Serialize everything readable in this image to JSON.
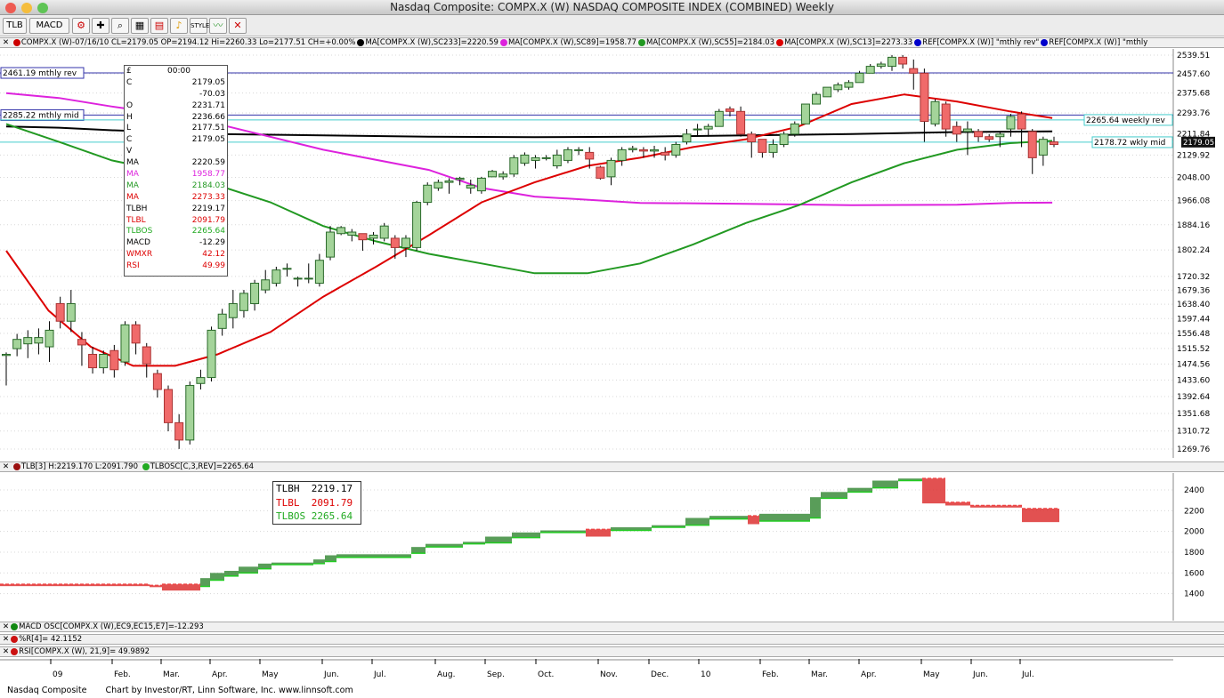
{
  "window": {
    "title": "Nasdaq Composite: COMPX.X (W) NASDAQ COMPOSITE INDEX (COMBINED) Weekly"
  },
  "toolbar": {
    "tlb_label": "TLB",
    "macd_label": "MACD",
    "icons": [
      "settings-icon",
      "crosshair-icon",
      "zoom-icon",
      "chart-style-icon",
      "alert-icon",
      "style-icon",
      "indicators-icon",
      "drawing-icon"
    ]
  },
  "price_pane": {
    "header_items": [
      {
        "text": "COMPX.X (W)-07/16/10 CL=2179.05 OP=2194.12 Hi=2260.33 Lo=2177.51 CH=+0.00%",
        "color": "#cc0000"
      },
      {
        "text": "MA[COMPX.X (W),SC233]=2220.59",
        "color": "#000000"
      },
      {
        "text": "MA[COMPX.X (W),SC89]=1958.77",
        "color": "#dd22dd"
      },
      {
        "text": "MA[COMPX.X (W),SC55]=2184.03",
        "color": "#229922"
      },
      {
        "text": "MA[COMPX.X (W),SC13]=2273.33",
        "color": "#dd0000"
      },
      {
        "text": "REF[COMPX.X (W)] \"mthly rev\"",
        "color": "#0000cc"
      },
      {
        "text": "REF[COMPX.X (W)] \"mthly",
        "color": "#0000cc"
      }
    ],
    "y_ticks": [
      "2539.51",
      "2457.60",
      "2375.68",
      "2293.76",
      "2211.84",
      "2129.92",
      "2048.00",
      "1966.08",
      "1884.16",
      "1802.24",
      "1720.32",
      "1679.36",
      "1638.40",
      "1597.44",
      "1556.48",
      "1515.52",
      "1474.56",
      "1433.60",
      "1392.64",
      "1351.68",
      "1310.72",
      "1269.76"
    ],
    "ref_lines": [
      {
        "label": "2461.19 mthly rev",
        "value": 2461.19
      },
      {
        "label": "2285.22 mthly mid",
        "value": 2285.22
      },
      {
        "label": "2265.64 weekly rev",
        "value": 2265.64
      },
      {
        "label": "2178.72 wkly mid",
        "value": 2178.72
      }
    ],
    "last_price": "2179.05"
  },
  "data_window": {
    "rows": [
      {
        "k": "£",
        "v": "00:00",
        "c": "#000"
      },
      {
        "k": "C",
        "v": "2179.05",
        "c": "#000"
      },
      {
        "k": "",
        "v": "-70.03",
        "c": "#000"
      },
      {
        "k": "O",
        "v": "2231.71",
        "c": "#000"
      },
      {
        "k": "H",
        "v": "2236.66",
        "c": "#000"
      },
      {
        "k": "L",
        "v": "2177.51",
        "c": "#000"
      },
      {
        "k": "C",
        "v": "2179.05",
        "c": "#000"
      },
      {
        "k": "V",
        "v": "",
        "c": "#000"
      },
      {
        "k": "MA",
        "v": "2220.59",
        "c": "#000"
      },
      {
        "k": "MA",
        "v": "1958.77",
        "c": "#dd22dd"
      },
      {
        "k": "MA",
        "v": "2184.03",
        "c": "#229922"
      },
      {
        "k": "MA",
        "v": "2273.33",
        "c": "#dd0000"
      },
      {
        "k": "TLBH",
        "v": "2219.17",
        "c": "#000"
      },
      {
        "k": "TLBL",
        "v": "2091.79",
        "c": "#dd0000"
      },
      {
        "k": "TLBOS",
        "v": "2265.64",
        "c": "#22aa22"
      },
      {
        "k": "MACD",
        "v": "-12.29",
        "c": "#000"
      },
      {
        "k": "WMXR",
        "v": "42.12",
        "c": "#dd0000"
      },
      {
        "k": "RSI",
        "v": "49.99",
        "c": "#dd0000"
      }
    ]
  },
  "tlb_pane": {
    "header": "TLB[3] H:2219.170 L:2091.790",
    "header2": "TLBOSC[C,3,REV]=2265.64",
    "legend": [
      {
        "label": "TLBH  2219.17",
        "color": "#000"
      },
      {
        "label": "TLBL  2091.79",
        "color": "#dd0000"
      },
      {
        "label": "TLBOS 2265.64",
        "color": "#22aa22"
      }
    ],
    "y_ticks": [
      "2400",
      "2200",
      "2000",
      "1800",
      "1600",
      "1400"
    ]
  },
  "indicator_panes": [
    {
      "label": "MACD OSC[COMPX.X (W),EC9,EC15,E7]=-12.293"
    },
    {
      "label": "%R[4]= 42.1152"
    },
    {
      "label": "RSI[COMPX.X (W), 21,9]= 49.9892"
    }
  ],
  "x_axis": {
    "labels": [
      "09",
      "Feb.",
      "Mar.",
      "Apr.",
      "May",
      "Jun.",
      "Jul.",
      "Aug.",
      "Sep.",
      "Oct.",
      "Nov.",
      "Dec.",
      "10",
      "Feb.",
      "Mar.",
      "Apr.",
      "May",
      "Jun.",
      "Jul."
    ]
  },
  "footer": {
    "symbol": "Nasdaq Composite",
    "credit": "Chart by Investor/RT, Linn Software, Inc. www.linnsoft.com"
  },
  "chart_data": {
    "type": "candlestick",
    "title": "Nasdaq Composite: COMPX.X (W) NASDAQ COMPOSITE INDEX (COMBINED) Weekly",
    "ylim": [
      1269.76,
      2539.51
    ],
    "x_labels": [
      "09",
      "Feb.",
      "Mar.",
      "Apr.",
      "May",
      "Jun.",
      "Jul.",
      "Aug.",
      "Sep.",
      "Oct.",
      "Nov.",
      "Dec.",
      "10",
      "Feb.",
      "Mar.",
      "Apr.",
      "May",
      "Jun.",
      "Jul."
    ],
    "candles": [
      [
        1497,
        1500,
        1420,
        1505
      ],
      [
        1515,
        1540,
        1495,
        1555
      ],
      [
        1528,
        1545,
        1490,
        1565
      ],
      [
        1530,
        1545,
        1500,
        1570
      ],
      [
        1520,
        1565,
        1480,
        1590
      ],
      [
        1640,
        1590,
        1570,
        1660
      ],
      [
        1590,
        1640,
        1560,
        1680
      ],
      [
        1540,
        1525,
        1470,
        1560
      ],
      [
        1500,
        1465,
        1450,
        1520
      ],
      [
        1465,
        1500,
        1450,
        1510
      ],
      [
        1510,
        1460,
        1440,
        1525
      ],
      [
        1480,
        1580,
        1470,
        1590
      ],
      [
        1580,
        1530,
        1500,
        1590
      ],
      [
        1520,
        1475,
        1440,
        1530
      ],
      [
        1450,
        1410,
        1390,
        1460
      ],
      [
        1410,
        1330,
        1310,
        1420
      ],
      [
        1330,
        1290,
        1270,
        1350
      ],
      [
        1290,
        1420,
        1280,
        1430
      ],
      [
        1425,
        1440,
        1410,
        1460
      ],
      [
        1440,
        1565,
        1430,
        1575
      ],
      [
        1570,
        1610,
        1550,
        1625
      ],
      [
        1600,
        1640,
        1570,
        1680
      ],
      [
        1620,
        1670,
        1600,
        1680
      ],
      [
        1640,
        1700,
        1620,
        1710
      ],
      [
        1680,
        1710,
        1670,
        1740
      ],
      [
        1700,
        1740,
        1690,
        1750
      ],
      [
        1745,
        1745,
        1720,
        1760
      ],
      [
        1715,
        1715,
        1690,
        1720
      ],
      [
        1715,
        1715,
        1700,
        1760
      ],
      [
        1700,
        1770,
        1690,
        1790
      ],
      [
        1780,
        1860,
        1770,
        1880
      ],
      [
        1855,
        1875,
        1850,
        1880
      ],
      [
        1850,
        1860,
        1830,
        1870
      ],
      [
        1855,
        1835,
        1800,
        1850
      ],
      [
        1840,
        1850,
        1820,
        1860
      ],
      [
        1840,
        1880,
        1830,
        1890
      ],
      [
        1840,
        1810,
        1775,
        1850
      ],
      [
        1810,
        1840,
        1780,
        1850
      ],
      [
        1810,
        1960,
        1800,
        1965
      ],
      [
        1960,
        2020,
        1950,
        2030
      ],
      [
        2010,
        2030,
        2000,
        2040
      ],
      [
        2030,
        2035,
        1990,
        2045
      ],
      [
        2040,
        2045,
        2020,
        2050
      ],
      [
        2010,
        2020,
        1990,
        2040
      ],
      [
        2000,
        2045,
        1990,
        2050
      ],
      [
        2050,
        2070,
        2050,
        2075
      ],
      [
        2050,
        2060,
        2040,
        2070
      ],
      [
        2060,
        2120,
        2050,
        2130
      ],
      [
        2100,
        2130,
        2090,
        2140
      ],
      [
        2110,
        2120,
        2080,
        2130
      ],
      [
        2120,
        2120,
        2110,
        2130
      ],
      [
        2090,
        2130,
        2080,
        2150
      ],
      [
        2110,
        2150,
        2100,
        2160
      ],
      [
        2150,
        2150,
        2130,
        2160
      ],
      [
        2140,
        2115,
        2080,
        2160
      ],
      [
        2085,
        2045,
        2040,
        2090
      ],
      [
        2050,
        2110,
        2020,
        2120
      ],
      [
        2110,
        2150,
        2090,
        2160
      ],
      [
        2150,
        2155,
        2140,
        2165
      ],
      [
        2150,
        2145,
        2120,
        2160
      ],
      [
        2145,
        2150,
        2120,
        2165
      ],
      [
        2140,
        2130,
        2110,
        2160
      ],
      [
        2130,
        2170,
        2120,
        2180
      ],
      [
        2180,
        2210,
        2170,
        2230
      ],
      [
        2230,
        2230,
        2200,
        2250
      ],
      [
        2230,
        2240,
        2200,
        2250
      ],
      [
        2240,
        2300,
        2240,
        2310
      ],
      [
        2310,
        2300,
        2280,
        2320
      ],
      [
        2300,
        2210,
        2200,
        2320
      ],
      [
        2210,
        2180,
        2120,
        2220
      ],
      [
        2190,
        2140,
        2120,
        2190
      ],
      [
        2140,
        2170,
        2120,
        2190
      ],
      [
        2170,
        2210,
        2160,
        2220
      ],
      [
        2210,
        2250,
        2200,
        2260
      ],
      [
        2250,
        2330,
        2250,
        2330
      ],
      [
        2330,
        2370,
        2330,
        2380
      ],
      [
        2360,
        2400,
        2360,
        2400
      ],
      [
        2390,
        2410,
        2380,
        2420
      ],
      [
        2400,
        2420,
        2390,
        2430
      ],
      [
        2420,
        2460,
        2420,
        2470
      ],
      [
        2460,
        2490,
        2460,
        2500
      ],
      [
        2490,
        2500,
        2480,
        2510
      ],
      [
        2490,
        2530,
        2470,
        2540
      ],
      [
        2530,
        2500,
        2480,
        2540
      ],
      [
        2480,
        2460,
        2390,
        2520
      ],
      [
        2460,
        2260,
        2180,
        2480
      ],
      [
        2250,
        2340,
        2240,
        2350
      ],
      [
        2330,
        2230,
        2200,
        2340
      ],
      [
        2240,
        2210,
        2180,
        2260
      ],
      [
        2220,
        2230,
        2130,
        2260
      ],
      [
        2220,
        2200,
        2180,
        2230
      ],
      [
        2200,
        2190,
        2180,
        2210
      ],
      [
        2200,
        2210,
        2160,
        2220
      ],
      [
        2230,
        2280,
        2200,
        2290
      ],
      [
        2290,
        2230,
        2160,
        2300
      ],
      [
        2220,
        2120,
        2060,
        2230
      ],
      [
        2130,
        2190,
        2090,
        2200
      ],
      [
        2180,
        2170,
        2160,
        2200
      ]
    ],
    "series": [
      {
        "name": "MA SC233",
        "color": "#000000",
        "values": [
          [
            0,
            2240
          ],
          [
            0.05,
            2235
          ],
          [
            0.1,
            2225
          ],
          [
            0.2,
            2210
          ],
          [
            0.3,
            2205
          ],
          [
            0.4,
            2200
          ],
          [
            0.5,
            2198
          ],
          [
            0.6,
            2200
          ],
          [
            0.7,
            2205
          ],
          [
            0.8,
            2210
          ],
          [
            0.9,
            2218
          ],
          [
            0.99,
            2220.59
          ]
        ]
      },
      {
        "name": "MA SC89",
        "color": "#dd22dd",
        "values": [
          [
            0,
            2375
          ],
          [
            0.05,
            2355
          ],
          [
            0.1,
            2320
          ],
          [
            0.15,
            2290
          ],
          [
            0.2,
            2250
          ],
          [
            0.3,
            2150
          ],
          [
            0.4,
            2075
          ],
          [
            0.45,
            2010
          ],
          [
            0.5,
            1980
          ],
          [
            0.6,
            1958
          ],
          [
            0.7,
            1955
          ],
          [
            0.8,
            1950
          ],
          [
            0.9,
            1952
          ],
          [
            0.95,
            1958
          ],
          [
            0.99,
            1958.77
          ]
        ]
      },
      {
        "name": "MA SC55",
        "color": "#229922",
        "values": [
          [
            0,
            2250
          ],
          [
            0.05,
            2180
          ],
          [
            0.1,
            2110
          ],
          [
            0.15,
            2070
          ],
          [
            0.2,
            2020
          ],
          [
            0.25,
            1960
          ],
          [
            0.3,
            1880
          ],
          [
            0.35,
            1830
          ],
          [
            0.4,
            1790
          ],
          [
            0.45,
            1760
          ],
          [
            0.5,
            1730
          ],
          [
            0.55,
            1730
          ],
          [
            0.6,
            1760
          ],
          [
            0.65,
            1820
          ],
          [
            0.7,
            1890
          ],
          [
            0.75,
            1950
          ],
          [
            0.8,
            2030
          ],
          [
            0.85,
            2100
          ],
          [
            0.9,
            2150
          ],
          [
            0.95,
            2175
          ],
          [
            0.99,
            2184.03
          ]
        ]
      },
      {
        "name": "MA SC13",
        "color": "#dd0000",
        "values": [
          [
            0,
            1800
          ],
          [
            0.04,
            1620
          ],
          [
            0.08,
            1520
          ],
          [
            0.12,
            1470
          ],
          [
            0.16,
            1470
          ],
          [
            0.2,
            1500
          ],
          [
            0.25,
            1560
          ],
          [
            0.3,
            1660
          ],
          [
            0.35,
            1750
          ],
          [
            0.4,
            1850
          ],
          [
            0.45,
            1960
          ],
          [
            0.5,
            2030
          ],
          [
            0.55,
            2090
          ],
          [
            0.6,
            2120
          ],
          [
            0.65,
            2160
          ],
          [
            0.7,
            2190
          ],
          [
            0.75,
            2240
          ],
          [
            0.8,
            2330
          ],
          [
            0.85,
            2370
          ],
          [
            0.9,
            2340
          ],
          [
            0.95,
            2300
          ],
          [
            0.99,
            2273.33
          ]
        ]
      }
    ]
  }
}
